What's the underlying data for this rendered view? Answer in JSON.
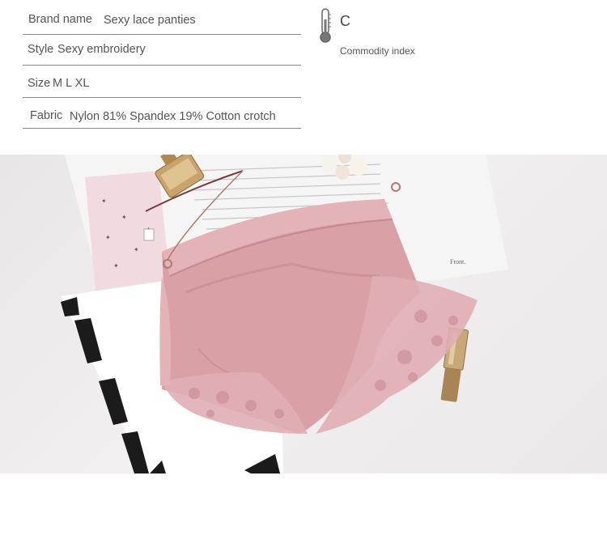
{
  "specs": {
    "brand": {
      "label": "Brand name",
      "value": "Sexy lace panties"
    },
    "style": {
      "label": "Style",
      "value": "Sexy embroidery"
    },
    "size": {
      "label": "Size",
      "value": "M L XL"
    },
    "fabric": {
      "label": "Fabric",
      "value": "Nylon 81%  Spandex 19% Cotton crotch"
    }
  },
  "commodity_index": {
    "letter": "C",
    "label": "Commodity index",
    "icon": "thermometer-icon"
  },
  "photo": {
    "description_icon": "product-photo",
    "text_on_card": "Front."
  },
  "colors": {
    "product_pink": "#d9a0a6",
    "text": "#555555",
    "divider": "#8a8a8a"
  }
}
